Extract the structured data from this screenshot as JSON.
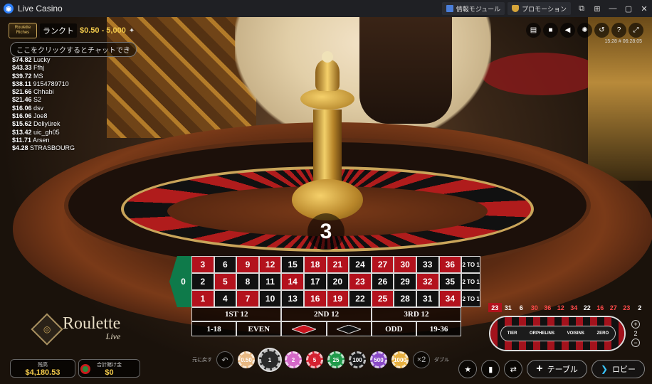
{
  "window": {
    "title": "Live Casino",
    "btn_gamemodule": "情報モジュール",
    "btn_promotion": "プロモーション",
    "controls": [
      "⧉",
      "⊞",
      "—",
      "▢",
      "✕"
    ]
  },
  "overlay": {
    "brand": "Roulette Riches",
    "rank_label": "ランク",
    "rank_suffix": "ト",
    "limits": "$0.50 - 5,000",
    "chat_hint": "ここをクリックするとチャットでき",
    "time": "15:28  # 06:28:05",
    "winners": [
      {
        "amt": "$74.82",
        "name": "Lucky"
      },
      {
        "amt": "$43.33",
        "name": "Ffhj"
      },
      {
        "amt": "$39.72",
        "name": "MS"
      },
      {
        "amt": "$38.11",
        "name": "9154789710"
      },
      {
        "amt": "$21.66",
        "name": "Chhabi"
      },
      {
        "amt": "$21.46",
        "name": "S2"
      },
      {
        "amt": "$16.06",
        "name": "dsv"
      },
      {
        "amt": "$16.06",
        "name": "Joe8"
      },
      {
        "amt": "$15.62",
        "name": "Deliyürek"
      },
      {
        "amt": "$13.42",
        "name": "uic_gh05"
      },
      {
        "amt": "$11.71",
        "name": "Arsen"
      },
      {
        "amt": "$4.28",
        "name": "STRASBOURG"
      }
    ]
  },
  "result_number": "3",
  "board": {
    "zero": "0",
    "rows": [
      [
        [
          "3",
          "red"
        ],
        [
          "6",
          "black"
        ],
        [
          "9",
          "red"
        ],
        [
          "12",
          "red"
        ],
        [
          "15",
          "black"
        ],
        [
          "18",
          "red"
        ],
        [
          "21",
          "red"
        ],
        [
          "24",
          "black"
        ],
        [
          "27",
          "red"
        ],
        [
          "30",
          "red"
        ],
        [
          "33",
          "black"
        ],
        [
          "36",
          "red"
        ]
      ],
      [
        [
          "2",
          "black"
        ],
        [
          "5",
          "red"
        ],
        [
          "8",
          "black"
        ],
        [
          "11",
          "black"
        ],
        [
          "14",
          "red"
        ],
        [
          "17",
          "black"
        ],
        [
          "20",
          "black"
        ],
        [
          "23",
          "red"
        ],
        [
          "26",
          "black"
        ],
        [
          "29",
          "black"
        ],
        [
          "32",
          "red"
        ],
        [
          "35",
          "black"
        ]
      ],
      [
        [
          "1",
          "red"
        ],
        [
          "4",
          "black"
        ],
        [
          "7",
          "red"
        ],
        [
          "10",
          "black"
        ],
        [
          "13",
          "black"
        ],
        [
          "16",
          "red"
        ],
        [
          "19",
          "red"
        ],
        [
          "22",
          "black"
        ],
        [
          "25",
          "red"
        ],
        [
          "28",
          "black"
        ],
        [
          "31",
          "black"
        ],
        [
          "34",
          "red"
        ]
      ]
    ],
    "col_label": "2 TO 1",
    "dozens": [
      "1ST 12",
      "2ND 12",
      "3RD 12"
    ],
    "outside": [
      "1-18",
      "EVEN",
      "",
      "",
      "ODD",
      "19-36"
    ]
  },
  "logo": {
    "title": "Roulette",
    "sub": "Live"
  },
  "recent_numbers": [
    {
      "n": "23",
      "c": "hl"
    },
    {
      "n": "31",
      "c": "b"
    },
    {
      "n": "6",
      "c": "b"
    },
    {
      "n": "30",
      "c": "r"
    },
    {
      "n": "36",
      "c": "r"
    },
    {
      "n": "12",
      "c": "r"
    },
    {
      "n": "34",
      "c": "r"
    },
    {
      "n": "22",
      "c": "b"
    },
    {
      "n": "16",
      "c": "r"
    },
    {
      "n": "27",
      "c": "r"
    },
    {
      "n": "23",
      "c": "r"
    },
    {
      "n": "2",
      "c": "b"
    }
  ],
  "racetrack": {
    "labels": [
      "TIER",
      "ORPHELINS",
      "VOISINS",
      "ZERO"
    ],
    "neighbours": "2"
  },
  "balance": {
    "label": "残高",
    "value": "$4,180.53"
  },
  "total_bet": {
    "label": "合計賭け金",
    "value": "$0"
  },
  "chips_bar": {
    "undo_label": "元に戻す",
    "double_label": "ダブル",
    "double_btn": "×2",
    "chips": [
      {
        "v": "0.50",
        "color": "#e8b882",
        "sel": false
      },
      {
        "v": "1",
        "color": "#2a2a2a",
        "sel": true
      },
      {
        "v": "2",
        "color": "#d468c8",
        "sel": false
      },
      {
        "v": "5",
        "color": "#d42030",
        "sel": false
      },
      {
        "v": "25",
        "color": "#1f9a4a",
        "sel": false
      },
      {
        "v": "100",
        "color": "#1a1a1a",
        "sel": false
      },
      {
        "v": "500",
        "color": "#8a4ac8",
        "sel": false
      },
      {
        "v": "1000",
        "color": "#e8b040",
        "sel": false
      }
    ]
  },
  "bottom_right": {
    "table_label": "テーブル",
    "lobby_label": "ロビー"
  }
}
